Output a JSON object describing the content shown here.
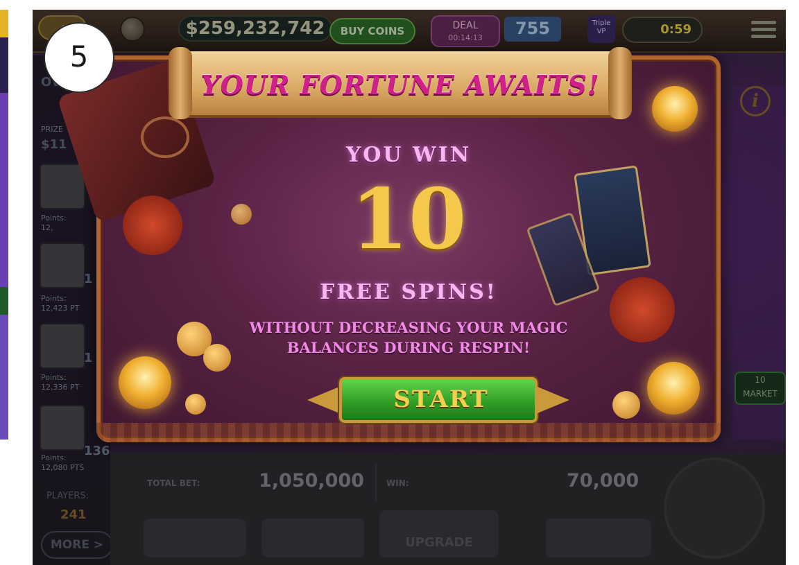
{
  "step": "5",
  "topbar": {
    "balance": "$259,232,742",
    "buy_coins": "BUY COINS",
    "deal_label": "DEAL",
    "deal_timer": "00:14:13",
    "level": "755",
    "vip": "Triple VP",
    "timer": "0:59"
  },
  "sidebar": {
    "header": "OV",
    "prize_label": "PRIZE",
    "prize_value": "$11",
    "entries": [
      {
        "points_label": "Points:",
        "points": "12,",
        "rank": ""
      },
      {
        "points_label": "Points:",
        "points": "12,423 PT",
        "rank": "1"
      },
      {
        "points_label": "Points:",
        "points": "12,336 PT",
        "rank": "1"
      },
      {
        "points_label": "Points:",
        "points": "12,080 PTS",
        "rank": "136"
      }
    ],
    "players_label": "PLAYERS:",
    "players_count": "241",
    "more": "MORE >"
  },
  "popup": {
    "title": "YOUR FORTUNE AWAITS!",
    "you_win": "YOU WIN",
    "spins_count": "10",
    "free_spins": "FREE SPINS!",
    "subtext_line1": "WITHOUT DECREASING YOUR MAGIC",
    "subtext_line2": "BALANCES DURING RESPIN!",
    "start": "START"
  },
  "right": {
    "info": "i",
    "market_count": "10",
    "market": "MARKET"
  },
  "bottom": {
    "total_bet_label": "TOTAL BET:",
    "total_bet": "1,050,000",
    "win_label": "WIN:",
    "win": "70,000",
    "upgrade": "UPGRADE"
  },
  "colors": {
    "banner_text": "#d0208a",
    "number_gold": "#f4c84a",
    "spins_pink": "#f7b8f0",
    "start_green": "#2f9a24"
  }
}
